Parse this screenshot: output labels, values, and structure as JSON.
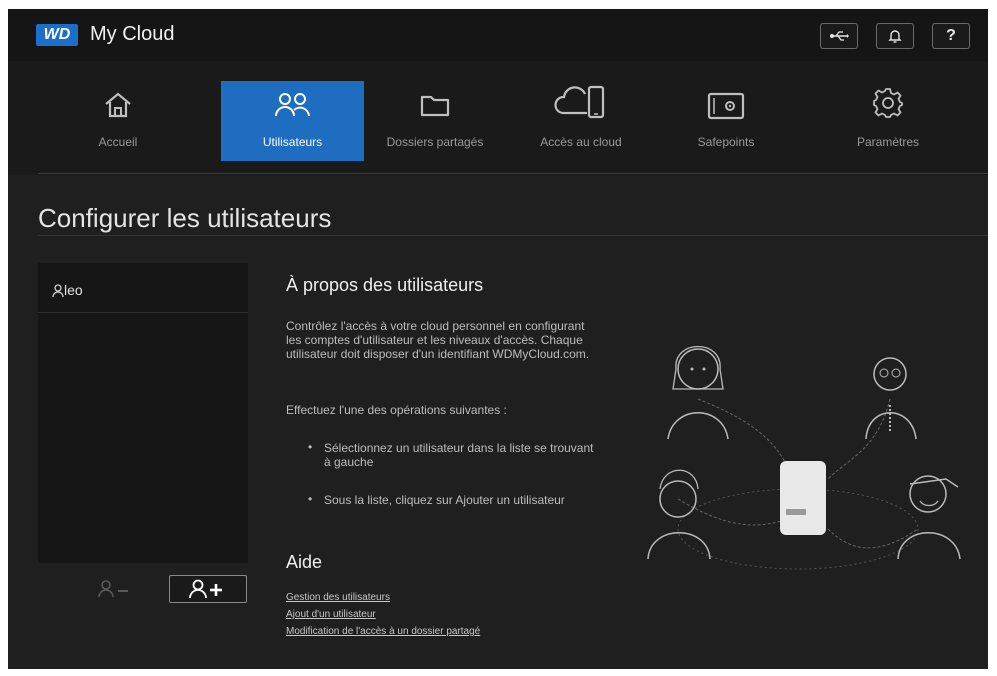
{
  "app": {
    "logo": "WD",
    "name": "My Cloud"
  },
  "topbar": {
    "usb_icon": "usb-icon",
    "bell_icon": "bell-icon",
    "help_label": "?"
  },
  "nav": {
    "tabs": [
      {
        "label": "Accueil",
        "icon": "home-icon"
      },
      {
        "label": "Utilisateurs",
        "icon": "users-icon",
        "active": true
      },
      {
        "label": "Dossiers partagés",
        "icon": "folder-icon"
      },
      {
        "label": "Accès au cloud",
        "icon": "cloud-device-icon"
      },
      {
        "label": "Safepoints",
        "icon": "safe-icon"
      },
      {
        "label": "Paramètres",
        "icon": "gear-icon"
      }
    ]
  },
  "page": {
    "title": "Configurer les utilisateurs"
  },
  "users": {
    "list": [
      {
        "name": "leo"
      }
    ]
  },
  "about": {
    "title": "À propos des utilisateurs",
    "intro": "Contrôlez l'accès à votre cloud personnel en configurant les comptes d'utilisateur et les niveaux d'accès. Chaque utilisateur doit disposer d'un identifiant WDMyCloud.com.",
    "instruction": "Effectuez l'une des opérations suivantes :",
    "bullets": [
      "Sélectionnez un utilisateur dans la liste se trouvant à gauche",
      "Sous la liste, cliquez sur Ajouter un utilisateur"
    ]
  },
  "help": {
    "title": "Aide",
    "links": [
      "Gestion des utilisateurs",
      "Ajout d'un utilisateur",
      "Modification de l'accès à un dossier partagé"
    ]
  },
  "colors": {
    "accent": "#1f6dc0",
    "background": "#1f1f1f",
    "topbar": "#151515"
  }
}
